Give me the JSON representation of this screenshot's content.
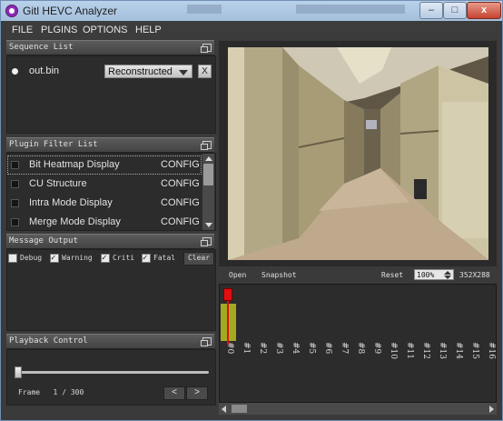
{
  "window": {
    "title": "Gitl HEVC Analyzer",
    "buttons": [
      "–",
      "□",
      "x"
    ]
  },
  "menu": [
    "FILE",
    "PLGINS",
    "OPTIONS",
    "HELP"
  ],
  "sequence_list": {
    "title": "Sequence List",
    "items": [
      {
        "name": "out.bin",
        "view": "Reconstructed",
        "remove_label": "X"
      }
    ]
  },
  "plugin_filter_list": {
    "title": "Plugin Filter List",
    "items": [
      {
        "name": "Bit Heatmap Display",
        "config": "CONFIG"
      },
      {
        "name": "CU Structure",
        "config": "CONFIG"
      },
      {
        "name": "Intra Mode Display",
        "config": "CONFIG"
      },
      {
        "name": "Merge Mode Display",
        "config": "CONFIG"
      }
    ]
  },
  "message_output": {
    "title": "Message Output",
    "filters": [
      {
        "label": "Debug",
        "checked": false
      },
      {
        "label": "Warning",
        "checked": true
      },
      {
        "label": "Criti",
        "checked": true
      },
      {
        "label": "Fatal",
        "checked": true
      }
    ],
    "clear_label": "Clear"
  },
  "playback_control": {
    "title": "Playback Control",
    "frame_label": "Frame",
    "current_frame": "1",
    "separator": "/",
    "total_frames": "300",
    "prev": "<",
    "next": ">"
  },
  "video_toolbar": {
    "open_label": "Open",
    "snapshot_label": "Snapshot",
    "reset_label": "Reset",
    "zoom": "100%",
    "resolution": "352X288"
  },
  "bitstream": {
    "frames": [
      "#0",
      "#1",
      "#2",
      "#3",
      "#4",
      "#5",
      "#6",
      "#7",
      "#8",
      "#9",
      "#10",
      "#11",
      "#12",
      "#13",
      "#14",
      "#15",
      "#16"
    ],
    "current_frame_index": 0,
    "bar_values": [
      0.75,
      0,
      0,
      0,
      0,
      0,
      0,
      0,
      0,
      0,
      0,
      0,
      0,
      0,
      0,
      0,
      0
    ],
    "colors": {
      "bar": "#a3aa1f",
      "cursor": "#e01010"
    }
  }
}
